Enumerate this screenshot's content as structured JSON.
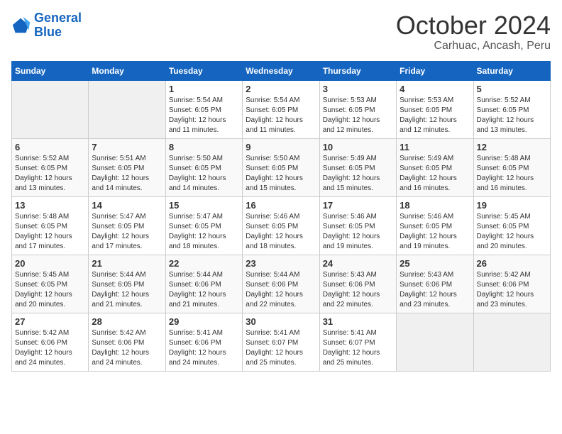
{
  "logo": {
    "line1": "General",
    "line2": "Blue"
  },
  "title": "October 2024",
  "subtitle": "Carhuac, Ancash, Peru",
  "days_of_week": [
    "Sunday",
    "Monday",
    "Tuesday",
    "Wednesday",
    "Thursday",
    "Friday",
    "Saturday"
  ],
  "weeks": [
    [
      {
        "day": "",
        "empty": true
      },
      {
        "day": "",
        "empty": true
      },
      {
        "day": "1",
        "sunrise": "Sunrise: 5:54 AM",
        "sunset": "Sunset: 6:05 PM",
        "daylight": "Daylight: 12 hours and 11 minutes."
      },
      {
        "day": "2",
        "sunrise": "Sunrise: 5:54 AM",
        "sunset": "Sunset: 6:05 PM",
        "daylight": "Daylight: 12 hours and 11 minutes."
      },
      {
        "day": "3",
        "sunrise": "Sunrise: 5:53 AM",
        "sunset": "Sunset: 6:05 PM",
        "daylight": "Daylight: 12 hours and 12 minutes."
      },
      {
        "day": "4",
        "sunrise": "Sunrise: 5:53 AM",
        "sunset": "Sunset: 6:05 PM",
        "daylight": "Daylight: 12 hours and 12 minutes."
      },
      {
        "day": "5",
        "sunrise": "Sunrise: 5:52 AM",
        "sunset": "Sunset: 6:05 PM",
        "daylight": "Daylight: 12 hours and 13 minutes."
      }
    ],
    [
      {
        "day": "6",
        "sunrise": "Sunrise: 5:52 AM",
        "sunset": "Sunset: 6:05 PM",
        "daylight": "Daylight: 12 hours and 13 minutes."
      },
      {
        "day": "7",
        "sunrise": "Sunrise: 5:51 AM",
        "sunset": "Sunset: 6:05 PM",
        "daylight": "Daylight: 12 hours and 14 minutes."
      },
      {
        "day": "8",
        "sunrise": "Sunrise: 5:50 AM",
        "sunset": "Sunset: 6:05 PM",
        "daylight": "Daylight: 12 hours and 14 minutes."
      },
      {
        "day": "9",
        "sunrise": "Sunrise: 5:50 AM",
        "sunset": "Sunset: 6:05 PM",
        "daylight": "Daylight: 12 hours and 15 minutes."
      },
      {
        "day": "10",
        "sunrise": "Sunrise: 5:49 AM",
        "sunset": "Sunset: 6:05 PM",
        "daylight": "Daylight: 12 hours and 15 minutes."
      },
      {
        "day": "11",
        "sunrise": "Sunrise: 5:49 AM",
        "sunset": "Sunset: 6:05 PM",
        "daylight": "Daylight: 12 hours and 16 minutes."
      },
      {
        "day": "12",
        "sunrise": "Sunrise: 5:48 AM",
        "sunset": "Sunset: 6:05 PM",
        "daylight": "Daylight: 12 hours and 16 minutes."
      }
    ],
    [
      {
        "day": "13",
        "sunrise": "Sunrise: 5:48 AM",
        "sunset": "Sunset: 6:05 PM",
        "daylight": "Daylight: 12 hours and 17 minutes."
      },
      {
        "day": "14",
        "sunrise": "Sunrise: 5:47 AM",
        "sunset": "Sunset: 6:05 PM",
        "daylight": "Daylight: 12 hours and 17 minutes."
      },
      {
        "day": "15",
        "sunrise": "Sunrise: 5:47 AM",
        "sunset": "Sunset: 6:05 PM",
        "daylight": "Daylight: 12 hours and 18 minutes."
      },
      {
        "day": "16",
        "sunrise": "Sunrise: 5:46 AM",
        "sunset": "Sunset: 6:05 PM",
        "daylight": "Daylight: 12 hours and 18 minutes."
      },
      {
        "day": "17",
        "sunrise": "Sunrise: 5:46 AM",
        "sunset": "Sunset: 6:05 PM",
        "daylight": "Daylight: 12 hours and 19 minutes."
      },
      {
        "day": "18",
        "sunrise": "Sunrise: 5:46 AM",
        "sunset": "Sunset: 6:05 PM",
        "daylight": "Daylight: 12 hours and 19 minutes."
      },
      {
        "day": "19",
        "sunrise": "Sunrise: 5:45 AM",
        "sunset": "Sunset: 6:05 PM",
        "daylight": "Daylight: 12 hours and 20 minutes."
      }
    ],
    [
      {
        "day": "20",
        "sunrise": "Sunrise: 5:45 AM",
        "sunset": "Sunset: 6:05 PM",
        "daylight": "Daylight: 12 hours and 20 minutes."
      },
      {
        "day": "21",
        "sunrise": "Sunrise: 5:44 AM",
        "sunset": "Sunset: 6:05 PM",
        "daylight": "Daylight: 12 hours and 21 minutes."
      },
      {
        "day": "22",
        "sunrise": "Sunrise: 5:44 AM",
        "sunset": "Sunset: 6:06 PM",
        "daylight": "Daylight: 12 hours and 21 minutes."
      },
      {
        "day": "23",
        "sunrise": "Sunrise: 5:44 AM",
        "sunset": "Sunset: 6:06 PM",
        "daylight": "Daylight: 12 hours and 22 minutes."
      },
      {
        "day": "24",
        "sunrise": "Sunrise: 5:43 AM",
        "sunset": "Sunset: 6:06 PM",
        "daylight": "Daylight: 12 hours and 22 minutes."
      },
      {
        "day": "25",
        "sunrise": "Sunrise: 5:43 AM",
        "sunset": "Sunset: 6:06 PM",
        "daylight": "Daylight: 12 hours and 23 minutes."
      },
      {
        "day": "26",
        "sunrise": "Sunrise: 5:42 AM",
        "sunset": "Sunset: 6:06 PM",
        "daylight": "Daylight: 12 hours and 23 minutes."
      }
    ],
    [
      {
        "day": "27",
        "sunrise": "Sunrise: 5:42 AM",
        "sunset": "Sunset: 6:06 PM",
        "daylight": "Daylight: 12 hours and 24 minutes."
      },
      {
        "day": "28",
        "sunrise": "Sunrise: 5:42 AM",
        "sunset": "Sunset: 6:06 PM",
        "daylight": "Daylight: 12 hours and 24 minutes."
      },
      {
        "day": "29",
        "sunrise": "Sunrise: 5:41 AM",
        "sunset": "Sunset: 6:06 PM",
        "daylight": "Daylight: 12 hours and 24 minutes."
      },
      {
        "day": "30",
        "sunrise": "Sunrise: 5:41 AM",
        "sunset": "Sunset: 6:07 PM",
        "daylight": "Daylight: 12 hours and 25 minutes."
      },
      {
        "day": "31",
        "sunrise": "Sunrise: 5:41 AM",
        "sunset": "Sunset: 6:07 PM",
        "daylight": "Daylight: 12 hours and 25 minutes."
      },
      {
        "day": "",
        "empty": true
      },
      {
        "day": "",
        "empty": true
      }
    ]
  ]
}
